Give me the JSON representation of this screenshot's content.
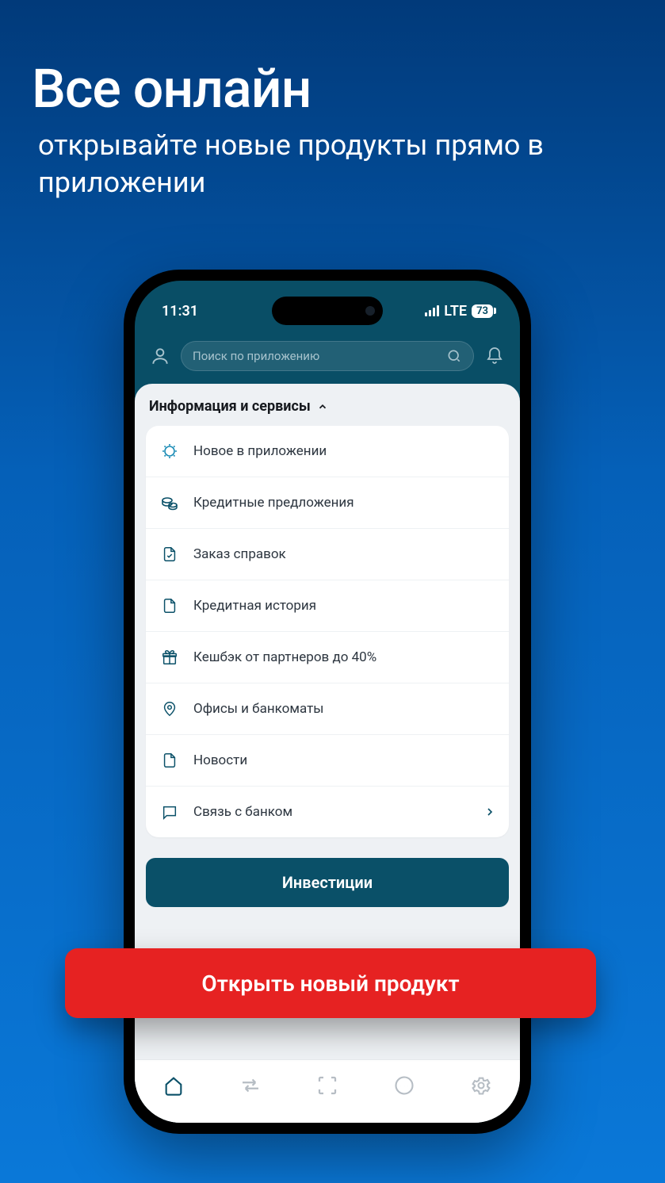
{
  "promo": {
    "title": "Все онлайн",
    "subtitle": "открывайте новые продукты прямо в приложении"
  },
  "status": {
    "time": "11:31",
    "network": "LTE",
    "battery": "73"
  },
  "search": {
    "placeholder": "Поиск по приложению"
  },
  "section": {
    "title": "Информация и сервисы"
  },
  "items": [
    {
      "label": "Новое в приложении",
      "icon": "new"
    },
    {
      "label": "Кредитные предложения",
      "icon": "coins"
    },
    {
      "label": "Заказ справок",
      "icon": "doc-check"
    },
    {
      "label": "Кредитная история",
      "icon": "doc"
    },
    {
      "label": "Кешбэк от партнеров до 40%",
      "icon": "gift"
    },
    {
      "label": "Офисы и банкоматы",
      "icon": "pin"
    },
    {
      "label": "Новости",
      "icon": "page"
    },
    {
      "label": "Связь с банком",
      "icon": "chat",
      "chevron": true
    }
  ],
  "buttons": {
    "invest": "Инвестиции",
    "cta": "Открыть новый продукт"
  }
}
